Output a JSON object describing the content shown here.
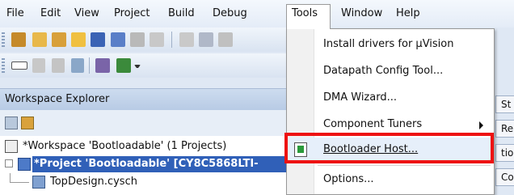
{
  "menubar": {
    "items": [
      {
        "label": "File",
        "hotkey": "F"
      },
      {
        "label": "Edit",
        "hotkey": "E"
      },
      {
        "label": "View",
        "hotkey": "V"
      },
      {
        "label": "Project",
        "hotkey": "P"
      },
      {
        "label": "Build",
        "hotkey": "B"
      },
      {
        "label": "Debug",
        "hotkey": "D"
      },
      {
        "label": "Tools",
        "hotkey": "T"
      },
      {
        "label": "Window",
        "hotkey": "W"
      },
      {
        "label": "Help",
        "hotkey": "H"
      }
    ]
  },
  "tools_menu": {
    "items": [
      {
        "label": "Install drivers for µVision"
      },
      {
        "label": "Datapath Config Tool..."
      },
      {
        "label": "DMA Wizard..."
      },
      {
        "label": "Component Tuners",
        "has_submenu": true
      },
      {
        "label": "Bootloader Host...",
        "highlighted": true
      },
      {
        "label": "Options..."
      }
    ]
  },
  "workspace": {
    "title": "Workspace Explorer",
    "rows": [
      {
        "label": "*Workspace 'Bootloadable' (1 Projects)"
      },
      {
        "label": "*Project  'Bootloadable'  [CY8C5868LTI-"
      },
      {
        "label": "TopDesign.cysch"
      }
    ]
  },
  "right_tabs": [
    "St",
    "Re",
    "tio",
    "Co"
  ],
  "colors": {
    "highlight_border": "#ee1111",
    "selection": "#3060b8"
  }
}
